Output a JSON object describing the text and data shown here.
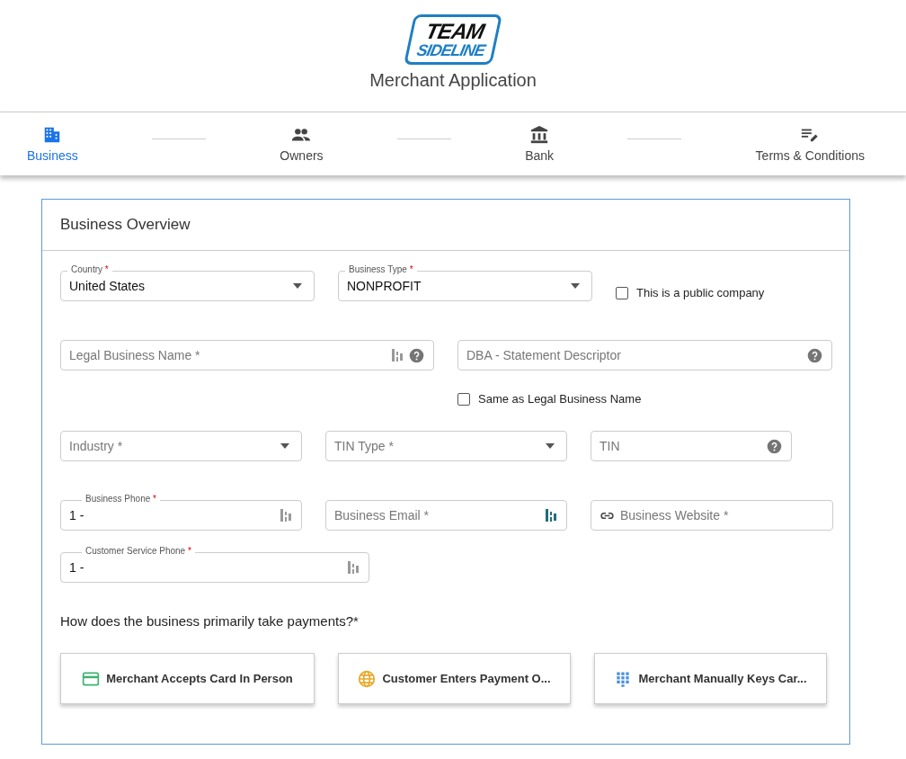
{
  "header": {
    "logo": {
      "line_1": "TEAM",
      "line_2": "SIDELINE"
    },
    "title": "Merchant Application"
  },
  "steps": [
    {
      "label": "Business",
      "selected": true
    },
    {
      "label": "Owners",
      "selected": false
    },
    {
      "label": "Bank",
      "selected": false
    },
    {
      "label": "Terms & Conditions",
      "selected": false
    }
  ],
  "section": {
    "title": "Business Overview",
    "rows": [
      [
        {
          "kind": "select",
          "label": "Country",
          "required_mark": "*",
          "value": "United States"
        },
        {
          "kind": "select",
          "label": "Business Type",
          "required_mark": "*",
          "value": "NONPROFIT"
        },
        {
          "kind": "checkbox",
          "label": "This is a public company",
          "checked": false
        }
      ],
      [
        {
          "kind": "text",
          "placeholder": "Legal Business Name *",
          "icons": [
            {
              "kind": "keeper",
              "highlighted": false
            },
            {
              "kind": "help"
            }
          ]
        },
        {
          "kind": "text",
          "placeholder": "DBA - Statement Descriptor",
          "icons": [
            {
              "kind": "help"
            }
          ]
        }
      ],
      [
        {
          "kind": "checkbox",
          "label": "Same as Legal Business Name",
          "checked": false
        }
      ],
      [
        {
          "kind": "select",
          "placeholder": "Industry *"
        },
        {
          "kind": "select",
          "placeholder": "TIN Type *"
        },
        {
          "kind": "text",
          "placeholder": "TIN",
          "icons": [
            {
              "kind": "help"
            }
          ]
        }
      ],
      [
        {
          "kind": "text",
          "label": "Business Phone",
          "required_mark": "*",
          "value": "1 -",
          "icons": [
            {
              "kind": "keeper",
              "highlighted": false
            }
          ]
        },
        {
          "kind": "text",
          "placeholder": "Business Email *",
          "icons": [
            {
              "kind": "keeper",
              "highlighted": true
            }
          ]
        },
        {
          "kind": "text",
          "placeholder": "Business Website *",
          "icons": [
            {
              "kind": "link"
            }
          ]
        }
      ],
      [
        {
          "kind": "text",
          "label": "Customer Service Phone",
          "required_mark": "*",
          "value": "1 -",
          "icons": [
            {
              "kind": "keeper",
              "highlighted": false
            }
          ]
        }
      ]
    ],
    "question": "How does the business primarily take payments?*",
    "options": [
      {
        "label": "Merchant Accepts Card In Person"
      },
      {
        "label": "Customer Enters Payment O..."
      },
      {
        "label": "Merchant Manually Keys Car..."
      }
    ]
  }
}
